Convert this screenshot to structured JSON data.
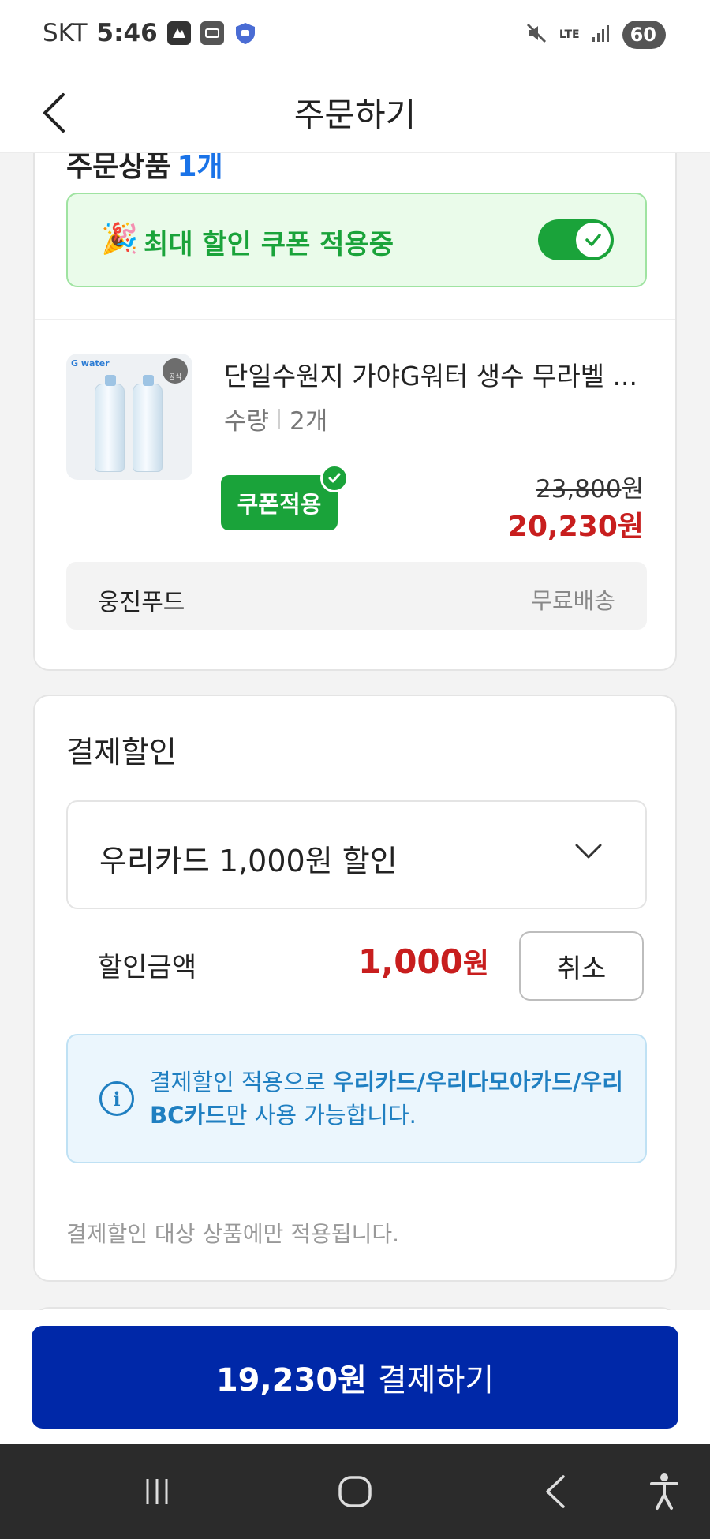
{
  "status_bar": {
    "carrier": "SKT",
    "time": "5:46",
    "network": "LTE",
    "battery": "60"
  },
  "header": {
    "title": "주문하기"
  },
  "order": {
    "section_title": "주문상품",
    "item_count": "1개",
    "coupon_banner_text": "최대 할인 쿠폰 적용중",
    "coupon_toggle_on": true,
    "product": {
      "name": "단일수원지 가야G워터 생수 무라벨 ...",
      "qty_label": "수량",
      "qty_value": "2개",
      "coupon_button": "쿠폰적용",
      "original_price": "23,800",
      "original_unit": "원",
      "final_price": "20,230원",
      "thumb_label": "G water",
      "thumb_badge": "공식"
    },
    "seller": "웅진푸드",
    "shipping": "무료배송"
  },
  "payment_discount": {
    "title": "결제할인",
    "selected_option": "우리카드 1,000원 할인",
    "amount_label": "할인금액",
    "amount_value": "1,000",
    "amount_unit": "원",
    "cancel_button": "취소",
    "info_prefix": "결제할인 적용으로 ",
    "info_bold": "우리카드/우리다모아카드/우리BC카드",
    "info_suffix": "만 사용 가능합니다.",
    "note": "결제할인 대상 상품에만 적용됩니다."
  },
  "checkout": {
    "amount": "19,230원",
    "label": "결제하기"
  },
  "colors": {
    "accent_green": "#1aa33a",
    "price_red": "#c81e1e",
    "pay_blue": "#0028a8",
    "info_blue": "#1f7fc1"
  },
  "icons": {
    "back": "chevron-left-icon",
    "toggle_check": "check-icon",
    "dropdown": "chevron-down-icon",
    "info": "info-icon",
    "nav_recent": "recent-apps-icon",
    "nav_home": "home-icon",
    "nav_back": "back-icon",
    "nav_accessibility": "accessibility-icon"
  }
}
